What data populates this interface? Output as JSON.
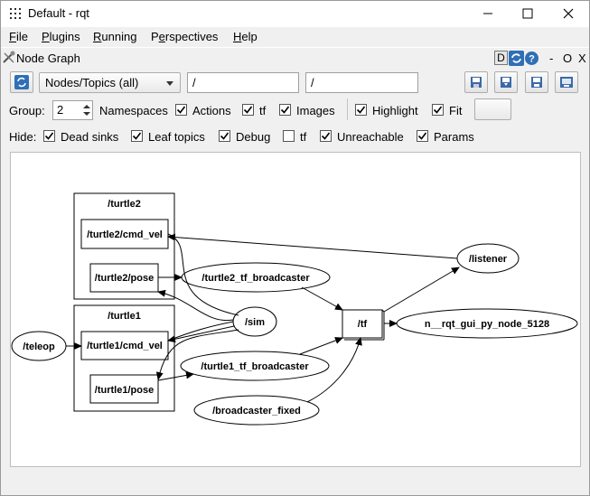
{
  "window": {
    "title": "Default - rqt"
  },
  "menu": [
    "File",
    "Plugins",
    "Running",
    "Perspectives",
    "Help"
  ],
  "menu_mnemonics": [
    "F",
    "P",
    "R",
    "e",
    "H"
  ],
  "plugin": {
    "title": "Node Graph",
    "controls": [
      "D",
      "-",
      "O",
      "X"
    ]
  },
  "toolbar": {
    "graph_type": "Nodes/Topics (all)",
    "node_filter": "/",
    "topic_filter": "/"
  },
  "options": {
    "group_label": "Group:",
    "group_value": "2",
    "namespaces_label": "Namespaces",
    "actions": {
      "label": "Actions",
      "checked": true
    },
    "tf": {
      "label": "tf",
      "checked": true
    },
    "images": {
      "label": "Images",
      "checked": true
    },
    "highlight": {
      "label": "Highlight",
      "checked": true
    },
    "fit": {
      "label": "Fit",
      "checked": true
    }
  },
  "hide": {
    "label": "Hide:",
    "dead_sinks": {
      "label": "Dead sinks",
      "checked": true
    },
    "leaf_topics": {
      "label": "Leaf topics",
      "checked": true
    },
    "debug": {
      "label": "Debug",
      "checked": true
    },
    "tf": {
      "label": "tf",
      "checked": false
    },
    "unreachable": {
      "label": "Unreachable",
      "checked": true
    },
    "params": {
      "label": "Params",
      "checked": true
    }
  },
  "graph": {
    "clusters": [
      "/turtle2",
      "/turtle1"
    ],
    "topics": [
      "/turtle2/cmd_vel",
      "/turtle2/pose",
      "/turtle1/cmd_vel",
      "/turtle1/pose",
      "/tf"
    ],
    "nodes": [
      "/listener",
      "/turtle2_tf_broadcaster",
      "/sim",
      "/teleop",
      "n__rqt_gui_py_node_5128",
      "/turtle1_tf_broadcaster",
      "/broadcaster_fixed"
    ]
  },
  "colors": {
    "chrome": "#f0f0f0",
    "canvas": "#ffffff",
    "icon_blue": "#2f6fb5"
  }
}
